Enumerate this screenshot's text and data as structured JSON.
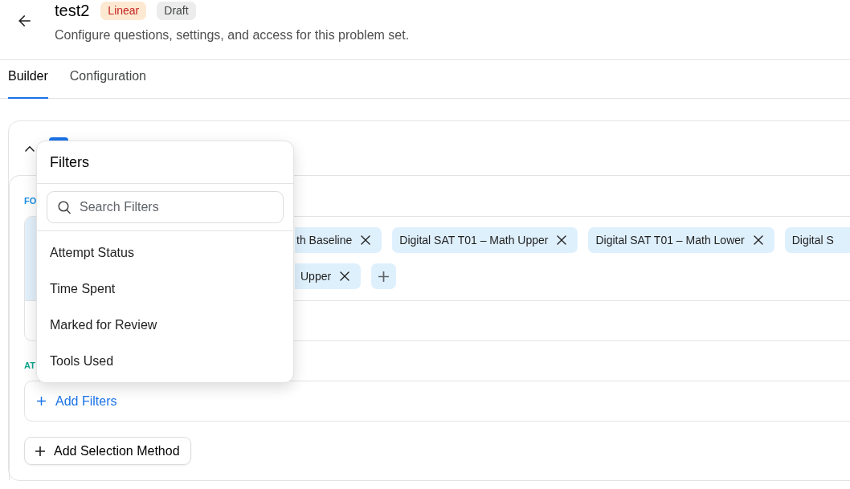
{
  "header": {
    "title": "test2",
    "badges": [
      {
        "label": "Linear",
        "kind": "mode"
      },
      {
        "label": "Draft",
        "kind": "status"
      }
    ],
    "subtitle": "Configure questions, settings, and access for this problem set."
  },
  "tabs": [
    {
      "label": "Builder",
      "selected": true
    },
    {
      "label": "Configuration",
      "selected": false
    }
  ],
  "section": {
    "expanded": true,
    "groups": [
      {
        "kind": "chips",
        "label": "FO",
        "color": "#1a8fe3",
        "chip_rows": [
          [
            {
              "label": "th Baseline",
              "removable": true
            },
            {
              "label": "Digital SAT T01 – Math Upper",
              "removable": true
            },
            {
              "label": "Digital SAT T01 – Math Lower",
              "removable": true
            },
            {
              "label": "Digital S",
              "removable": false
            }
          ],
          [
            {
              "label": "Upper",
              "removable": true
            }
          ]
        ]
      },
      {
        "kind": "filters",
        "label": "AT",
        "color": "#12a68e",
        "action": "Add Filters"
      }
    ],
    "add_button": "Add Selection Method"
  },
  "popover": {
    "title": "Filters",
    "search": {
      "placeholder": "Search Filters"
    },
    "items": [
      "Attempt Status",
      "Time Spent",
      "Marked for Review",
      "Tools Used"
    ]
  }
}
